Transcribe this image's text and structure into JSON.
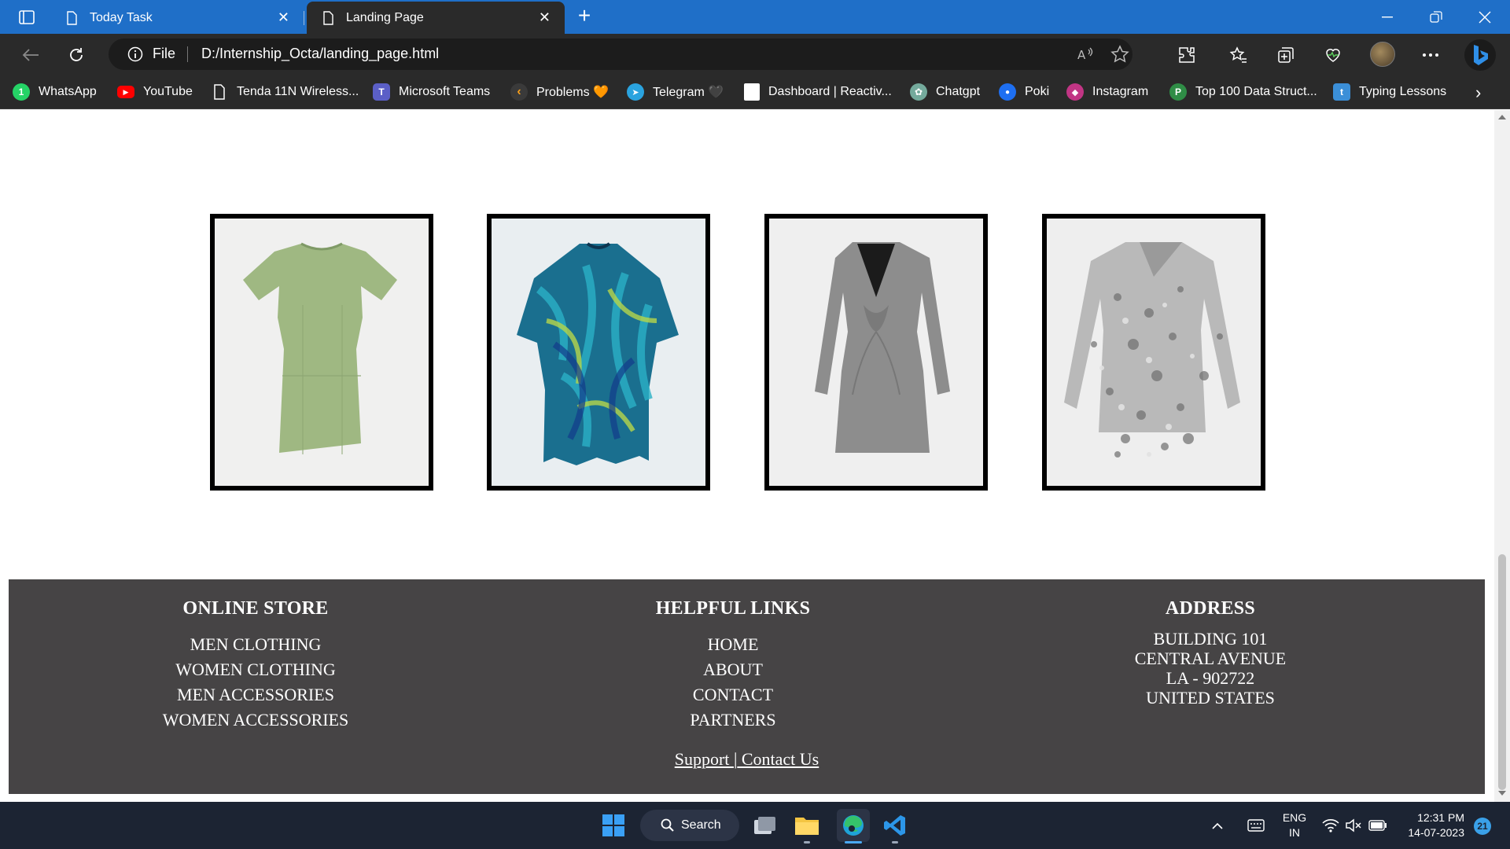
{
  "browser": {
    "tabs": [
      {
        "title": "Today Task",
        "active": false
      },
      {
        "title": "Landing Page",
        "active": true
      }
    ],
    "address": {
      "scheme_label": "File",
      "url": "D:/Internship_Octa/landing_page.html"
    },
    "favorites": [
      {
        "label": "WhatsApp",
        "icon": "whatsapp-icon",
        "color": "#25d366",
        "glyph": "1"
      },
      {
        "label": "YouTube",
        "icon": "youtube-icon",
        "color": "#ff0000",
        "glyph": "▶"
      },
      {
        "label": "Tenda 11N Wireless...",
        "icon": "page-icon",
        "color": "",
        "glyph": ""
      },
      {
        "label": "Microsoft Teams",
        "icon": "teams-icon",
        "color": "#5b5fc7",
        "glyph": "T"
      },
      {
        "label": "Problems 🧡",
        "icon": "leetcode-icon",
        "color": "#f89f1b",
        "glyph": "‹"
      },
      {
        "label": "Telegram 🖤",
        "icon": "telegram-icon",
        "color": "#2aa3df",
        "glyph": "➤"
      },
      {
        "label": "Dashboard | Reactiv...",
        "icon": "dashboard-icon",
        "color": "#ffffff",
        "glyph": ""
      },
      {
        "label": "Chatgpt",
        "icon": "chatgpt-icon",
        "color": "#74aa9c",
        "glyph": "✿"
      },
      {
        "label": "Poki",
        "icon": "poki-icon",
        "color": "#1e6ff1",
        "glyph": "●"
      },
      {
        "label": "Instagram",
        "icon": "instagram-icon",
        "color": "#c13584",
        "glyph": "◆"
      },
      {
        "label": "Top 100 Data Struct...",
        "icon": "gfg-icon",
        "color": "#2f8d46",
        "glyph": "P"
      },
      {
        "label": "Typing Lessons",
        "icon": "typing-icon",
        "color": "#3b8fd8",
        "glyph": "t"
      }
    ]
  },
  "products": [
    {
      "name": "green-tshirt-dress",
      "color": "#9fb882"
    },
    {
      "name": "blue-print-kaftan",
      "color": "#1a6f8f"
    },
    {
      "name": "grey-twist-dress",
      "color": "#8d8d8d"
    },
    {
      "name": "silver-sequin-dress",
      "color": "#b9b9b9"
    }
  ],
  "footer": {
    "online_store": {
      "heading": "ONLINE STORE",
      "links": [
        "MEN CLOTHING",
        "WOMEN CLOTHING",
        "MEN ACCESSORIES",
        "WOMEN ACCESSORIES"
      ]
    },
    "helpful_links": {
      "heading": "HELPFUL LINKS",
      "links": [
        "HOME",
        "ABOUT",
        "CONTACT",
        "PARTNERS"
      ]
    },
    "address": {
      "heading": "ADDRESS",
      "lines": [
        "BUILDING 101",
        "CENTRAL AVENUE",
        "LA - 902722",
        "UNITED STATES"
      ]
    },
    "bottom": {
      "support": "Support ",
      "separator": "|",
      "contact": " Contact Us"
    },
    "background": "#464445"
  },
  "taskbar": {
    "search_label": "Search",
    "language": {
      "line1": "ENG",
      "line2": "IN"
    },
    "time": "12:31 PM",
    "date": "14-07-2023",
    "notification_count": "21"
  }
}
